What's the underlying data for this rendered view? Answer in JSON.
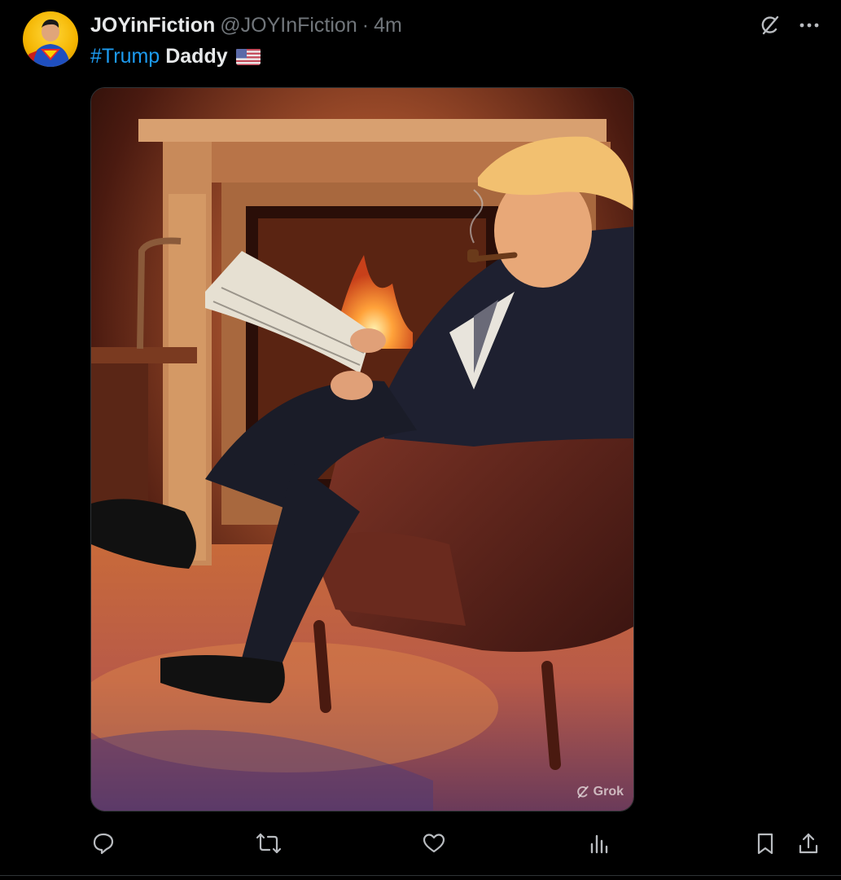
{
  "post": {
    "display_name": "JOYinFiction",
    "handle": "@JOYInFiction",
    "separator": "·",
    "time": "4m",
    "hashtag": "#Trump",
    "text": "Daddy",
    "flag_emoji": "us-flag-icon"
  },
  "media": {
    "watermark": "Grok"
  },
  "icons": {
    "grok": "grok-icon",
    "more": "more-icon",
    "reply": "reply-icon",
    "repost": "repost-icon",
    "like": "like-icon",
    "views": "views-icon",
    "bookmark": "bookmark-icon",
    "share": "share-icon"
  },
  "colors": {
    "background": "#000000",
    "text_primary": "#e7e9ea",
    "text_secondary": "#71767b",
    "hashtag": "#1d9bf0"
  }
}
